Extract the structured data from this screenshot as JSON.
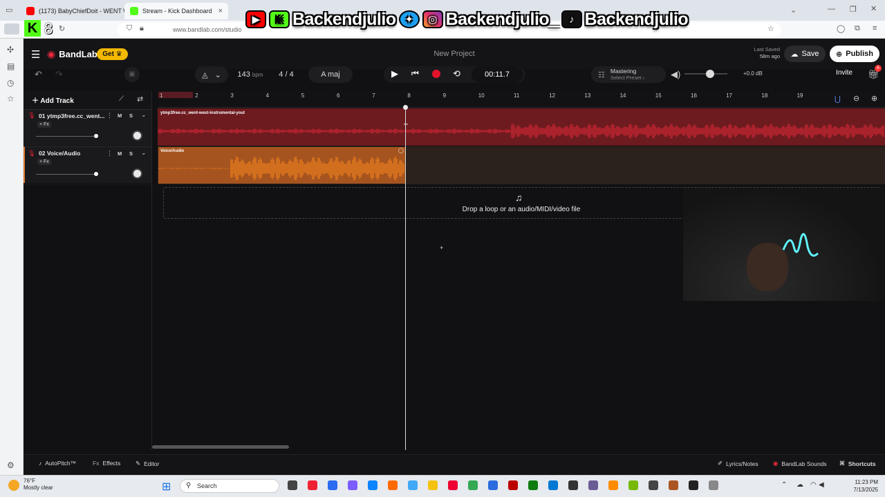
{
  "browser": {
    "tabs": [
      {
        "title": "(1173) BabyChiefDoit - WENT W",
        "color": "#f00"
      },
      {
        "title": "Stream - Kick Dashboard",
        "color": "#53fc18"
      }
    ],
    "url": "www.bandlab.com/studio"
  },
  "overlay": {
    "handle1": "Backendjulio",
    "handle2": "Backendjulio",
    "handle3": "Backendjulio_",
    "handle4": "Backendjulio",
    "kick_k": "K",
    "kick_num": "8"
  },
  "app": {
    "brand": "BandLab",
    "get_label": "Get",
    "project_title": "New Project",
    "last_saved_label": "Last Saved",
    "last_saved_value": "58m ago",
    "save_label": "Save",
    "publish_label": "Publish",
    "invite_label": "Invite",
    "gift_count": "6"
  },
  "toolbar": {
    "bpm": "143",
    "bpm_unit": "bpm",
    "time_sig": "4 / 4",
    "key": "A maj",
    "time": "00:11.7",
    "mastering": "Mastering",
    "select_preset": "Select Preset ›",
    "gain": "+0.0 dB",
    "volume_fraction": 0.6
  },
  "tracks": {
    "add_track": "Add Track",
    "fx_label": "+ Fx",
    "mute": "M",
    "solo": "S",
    "items": [
      {
        "num": "01",
        "name": "ytmp3free.cc_went...",
        "clip": "ytmp3free.cc_went-west-instrumental-yout"
      },
      {
        "num": "02",
        "name": "Voice/Audio",
        "clip": "Voice/Audio"
      }
    ]
  },
  "ruler": {
    "ticks": [
      "1",
      "2",
      "3",
      "4",
      "5",
      "6",
      "7",
      "8",
      "9",
      "10",
      "11",
      "12",
      "13",
      "14",
      "15",
      "16",
      "17",
      "18",
      "19"
    ]
  },
  "dropzone": {
    "text": "Drop a loop or an audio/MIDI/video file"
  },
  "bottom": {
    "autopitch": "AutoPitch™",
    "fx": "Fx",
    "effects": "Effects",
    "editor": "Editor",
    "lyrics": "Lyrics/Notes",
    "sounds": "BandLab Sounds",
    "shortcuts": "Shortcuts"
  },
  "taskbar": {
    "temp": "76°F",
    "weather": "Mostly clear",
    "search": "Search",
    "time": "11:23 PM",
    "date": "7/13/2025"
  },
  "colors": {
    "track1": "#6d1b1f",
    "track2": "#a6541f",
    "record": "#e3142a",
    "kick": "#53fc18"
  }
}
